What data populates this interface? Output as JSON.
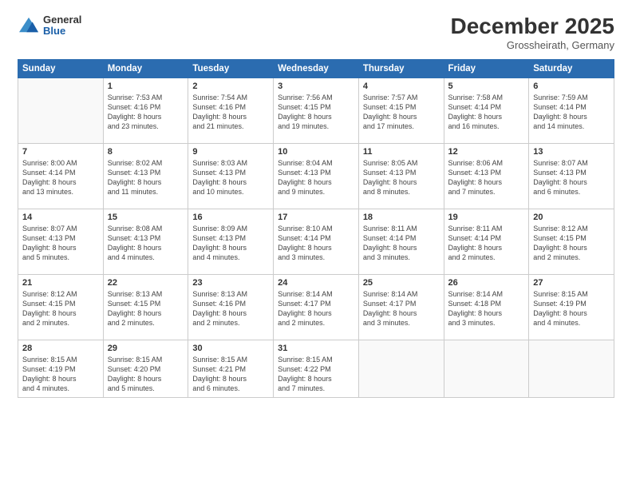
{
  "logo": {
    "line1": "General",
    "line2": "Blue"
  },
  "title": "December 2025",
  "subtitle": "Grossheirath, Germany",
  "headers": [
    "Sunday",
    "Monday",
    "Tuesday",
    "Wednesday",
    "Thursday",
    "Friday",
    "Saturday"
  ],
  "weeks": [
    [
      {
        "day": "",
        "info": ""
      },
      {
        "day": "1",
        "info": "Sunrise: 7:53 AM\nSunset: 4:16 PM\nDaylight: 8 hours\nand 23 minutes."
      },
      {
        "day": "2",
        "info": "Sunrise: 7:54 AM\nSunset: 4:16 PM\nDaylight: 8 hours\nand 21 minutes."
      },
      {
        "day": "3",
        "info": "Sunrise: 7:56 AM\nSunset: 4:15 PM\nDaylight: 8 hours\nand 19 minutes."
      },
      {
        "day": "4",
        "info": "Sunrise: 7:57 AM\nSunset: 4:15 PM\nDaylight: 8 hours\nand 17 minutes."
      },
      {
        "day": "5",
        "info": "Sunrise: 7:58 AM\nSunset: 4:14 PM\nDaylight: 8 hours\nand 16 minutes."
      },
      {
        "day": "6",
        "info": "Sunrise: 7:59 AM\nSunset: 4:14 PM\nDaylight: 8 hours\nand 14 minutes."
      }
    ],
    [
      {
        "day": "7",
        "info": "Sunrise: 8:00 AM\nSunset: 4:14 PM\nDaylight: 8 hours\nand 13 minutes."
      },
      {
        "day": "8",
        "info": "Sunrise: 8:02 AM\nSunset: 4:13 PM\nDaylight: 8 hours\nand 11 minutes."
      },
      {
        "day": "9",
        "info": "Sunrise: 8:03 AM\nSunset: 4:13 PM\nDaylight: 8 hours\nand 10 minutes."
      },
      {
        "day": "10",
        "info": "Sunrise: 8:04 AM\nSunset: 4:13 PM\nDaylight: 8 hours\nand 9 minutes."
      },
      {
        "day": "11",
        "info": "Sunrise: 8:05 AM\nSunset: 4:13 PM\nDaylight: 8 hours\nand 8 minutes."
      },
      {
        "day": "12",
        "info": "Sunrise: 8:06 AM\nSunset: 4:13 PM\nDaylight: 8 hours\nand 7 minutes."
      },
      {
        "day": "13",
        "info": "Sunrise: 8:07 AM\nSunset: 4:13 PM\nDaylight: 8 hours\nand 6 minutes."
      }
    ],
    [
      {
        "day": "14",
        "info": "Sunrise: 8:07 AM\nSunset: 4:13 PM\nDaylight: 8 hours\nand 5 minutes."
      },
      {
        "day": "15",
        "info": "Sunrise: 8:08 AM\nSunset: 4:13 PM\nDaylight: 8 hours\nand 4 minutes."
      },
      {
        "day": "16",
        "info": "Sunrise: 8:09 AM\nSunset: 4:13 PM\nDaylight: 8 hours\nand 4 minutes."
      },
      {
        "day": "17",
        "info": "Sunrise: 8:10 AM\nSunset: 4:14 PM\nDaylight: 8 hours\nand 3 minutes."
      },
      {
        "day": "18",
        "info": "Sunrise: 8:11 AM\nSunset: 4:14 PM\nDaylight: 8 hours\nand 3 minutes."
      },
      {
        "day": "19",
        "info": "Sunrise: 8:11 AM\nSunset: 4:14 PM\nDaylight: 8 hours\nand 2 minutes."
      },
      {
        "day": "20",
        "info": "Sunrise: 8:12 AM\nSunset: 4:15 PM\nDaylight: 8 hours\nand 2 minutes."
      }
    ],
    [
      {
        "day": "21",
        "info": "Sunrise: 8:12 AM\nSunset: 4:15 PM\nDaylight: 8 hours\nand 2 minutes."
      },
      {
        "day": "22",
        "info": "Sunrise: 8:13 AM\nSunset: 4:15 PM\nDaylight: 8 hours\nand 2 minutes."
      },
      {
        "day": "23",
        "info": "Sunrise: 8:13 AM\nSunset: 4:16 PM\nDaylight: 8 hours\nand 2 minutes."
      },
      {
        "day": "24",
        "info": "Sunrise: 8:14 AM\nSunset: 4:17 PM\nDaylight: 8 hours\nand 2 minutes."
      },
      {
        "day": "25",
        "info": "Sunrise: 8:14 AM\nSunset: 4:17 PM\nDaylight: 8 hours\nand 3 minutes."
      },
      {
        "day": "26",
        "info": "Sunrise: 8:14 AM\nSunset: 4:18 PM\nDaylight: 8 hours\nand 3 minutes."
      },
      {
        "day": "27",
        "info": "Sunrise: 8:15 AM\nSunset: 4:19 PM\nDaylight: 8 hours\nand 4 minutes."
      }
    ],
    [
      {
        "day": "28",
        "info": "Sunrise: 8:15 AM\nSunset: 4:19 PM\nDaylight: 8 hours\nand 4 minutes."
      },
      {
        "day": "29",
        "info": "Sunrise: 8:15 AM\nSunset: 4:20 PM\nDaylight: 8 hours\nand 5 minutes."
      },
      {
        "day": "30",
        "info": "Sunrise: 8:15 AM\nSunset: 4:21 PM\nDaylight: 8 hours\nand 6 minutes."
      },
      {
        "day": "31",
        "info": "Sunrise: 8:15 AM\nSunset: 4:22 PM\nDaylight: 8 hours\nand 7 minutes."
      },
      {
        "day": "",
        "info": ""
      },
      {
        "day": "",
        "info": ""
      },
      {
        "day": "",
        "info": ""
      }
    ]
  ]
}
